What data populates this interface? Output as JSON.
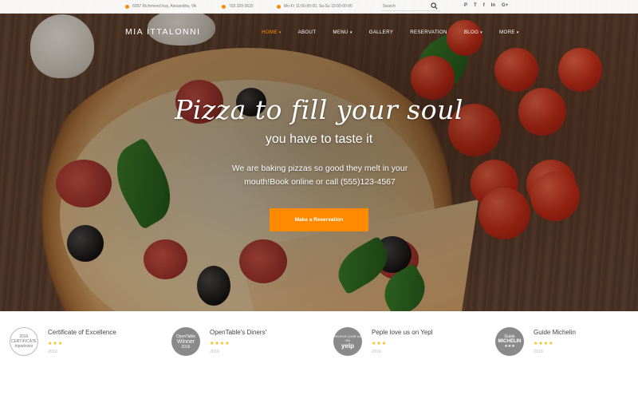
{
  "topbar": {
    "address": "6097 Richmond hwy, Alexandria, VA",
    "phone": "703 329 0632",
    "hours": "Mo-Fr 11:00-00:00, Sa-Su 15:00-00:00",
    "search_placeholder": "Search",
    "socials": [
      "P",
      "T",
      "f",
      "In",
      "G+"
    ]
  },
  "brand": "MIA ITTALONNI",
  "nav": [
    {
      "label": "HOME",
      "caret": "▾",
      "active": true
    },
    {
      "label": "ABOUT"
    },
    {
      "label": "MENU",
      "caret": "▾"
    },
    {
      "label": "GALLERY"
    },
    {
      "label": "RESERVATION"
    },
    {
      "label": "BLOG",
      "caret": "▾"
    },
    {
      "label": "MORE",
      "caret": "▾"
    }
  ],
  "hero": {
    "title": "Pizza to fill your soul",
    "subtitle": "you have to taste it",
    "description": "We are baking pizzas so good they melt in your mouth!Book online or call (555)123-4567",
    "cta": "Make a Reservation"
  },
  "awards": [
    {
      "badge": "tripadvisor",
      "badge_top": "2016",
      "badge_line2": "CERTIFICATE",
      "title": "Certificate of Excellence",
      "stars": "★★★",
      "year": "2016"
    },
    {
      "badge": "Winner",
      "badge_top": "OpenTable",
      "badge_line2": "2016",
      "title": "OpenTable's Diners'",
      "stars": "★★★★",
      "year": "2016"
    },
    {
      "badge": "yelp",
      "badge_top": "PEOPLE LOVE US ON",
      "badge_line2": "yelp",
      "title": "Peple love us on Yepl",
      "stars": "★★★",
      "year": "2016"
    },
    {
      "badge": "MICHELIN",
      "badge_top": "Guide",
      "badge_line2": "★★★",
      "title": "Guide Michelin",
      "stars": "★★★★",
      "year": "2016"
    }
  ],
  "colors": {
    "accent": "#ff8a00",
    "star": "#f5b700"
  }
}
